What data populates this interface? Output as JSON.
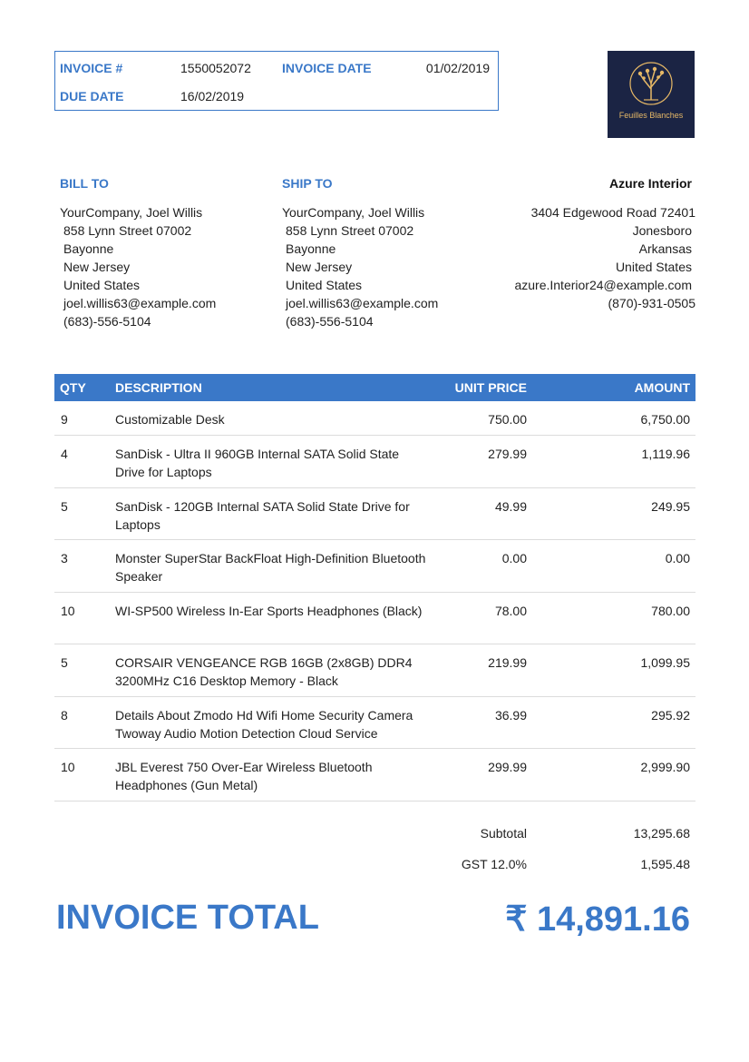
{
  "header": {
    "invoice_no_label": "INVOICE #",
    "invoice_no": "1550052072",
    "invoice_date_label": "INVOICE DATE",
    "invoice_date": "01/02/2019",
    "due_date_label": "DUE DATE",
    "due_date": "16/02/2019"
  },
  "logo": {
    "text": "Feuilles Blanches"
  },
  "bill_to": {
    "label": "BILL TO",
    "lines": [
      "YourCompany, Joel Willis",
      "858 Lynn Street 07002",
      "Bayonne",
      "New Jersey",
      "United States",
      "joel.willis63@example.com",
      "(683)-556-5104"
    ]
  },
  "ship_to": {
    "label": "SHIP TO",
    "lines": [
      "YourCompany, Joel Willis",
      "858 Lynn Street 07002",
      "Bayonne",
      "New Jersey",
      "United States",
      "joel.willis63@example.com",
      "(683)-556-5104"
    ]
  },
  "company": {
    "name": "Azure Interior",
    "lines": [
      "3404 Edgewood Road 72401",
      "Jonesboro",
      "Arkansas",
      "United States",
      "azure.Interior24@example.com",
      "(870)-931-0505"
    ]
  },
  "table": {
    "headers": {
      "qty": "QTY",
      "description": "DESCRIPTION",
      "unit_price": "UNIT PRICE",
      "amount": "AMOUNT"
    },
    "rows": [
      {
        "qty": "9",
        "description": "Customizable Desk",
        "unit_price": "750.00",
        "amount": "6,750.00"
      },
      {
        "qty": "4",
        "description": "SanDisk - Ultra II 960GB Internal SATA Solid State Drive for Laptops",
        "unit_price": "279.99",
        "amount": "1,119.96"
      },
      {
        "qty": "5",
        "description": "SanDisk - 120GB Internal SATA Solid State Drive for Laptops",
        "unit_price": "49.99",
        "amount": "249.95"
      },
      {
        "qty": "3",
        "description": "Monster SuperStar BackFloat High-Definition Bluetooth Speaker",
        "unit_price": "0.00",
        "amount": "0.00"
      },
      {
        "qty": "10",
        "description": "WI-SP500 Wireless In-Ear Sports Headphones (Black)",
        "unit_price": "78.00",
        "amount": "780.00"
      },
      {
        "qty": "5",
        "description": "CORSAIR VENGEANCE RGB 16GB (2x8GB) DDR4 3200MHz C16 Desktop Memory - Black",
        "unit_price": "219.99",
        "amount": "1,099.95"
      },
      {
        "qty": "8",
        "description": "Details About Zmodo Hd Wifi Home Security Camera Twoway Audio Motion Detection Cloud Service",
        "unit_price": "36.99",
        "amount": "295.92"
      },
      {
        "qty": "10",
        "description": "JBL Everest 750 Over-Ear Wireless Bluetooth Headphones (Gun Metal)",
        "unit_price": "299.99",
        "amount": "2,999.90"
      }
    ]
  },
  "summary": {
    "subtotal_label": "Subtotal",
    "subtotal": "13,295.68",
    "tax_label": "GST 12.0%",
    "tax": "1,595.48",
    "total_label": "INVOICE TOTAL",
    "total": "₹ 14,891.16"
  },
  "colors": {
    "accent": "#3a78c8",
    "logo_bg": "#1b2444",
    "logo_gold": "#e6b866"
  }
}
